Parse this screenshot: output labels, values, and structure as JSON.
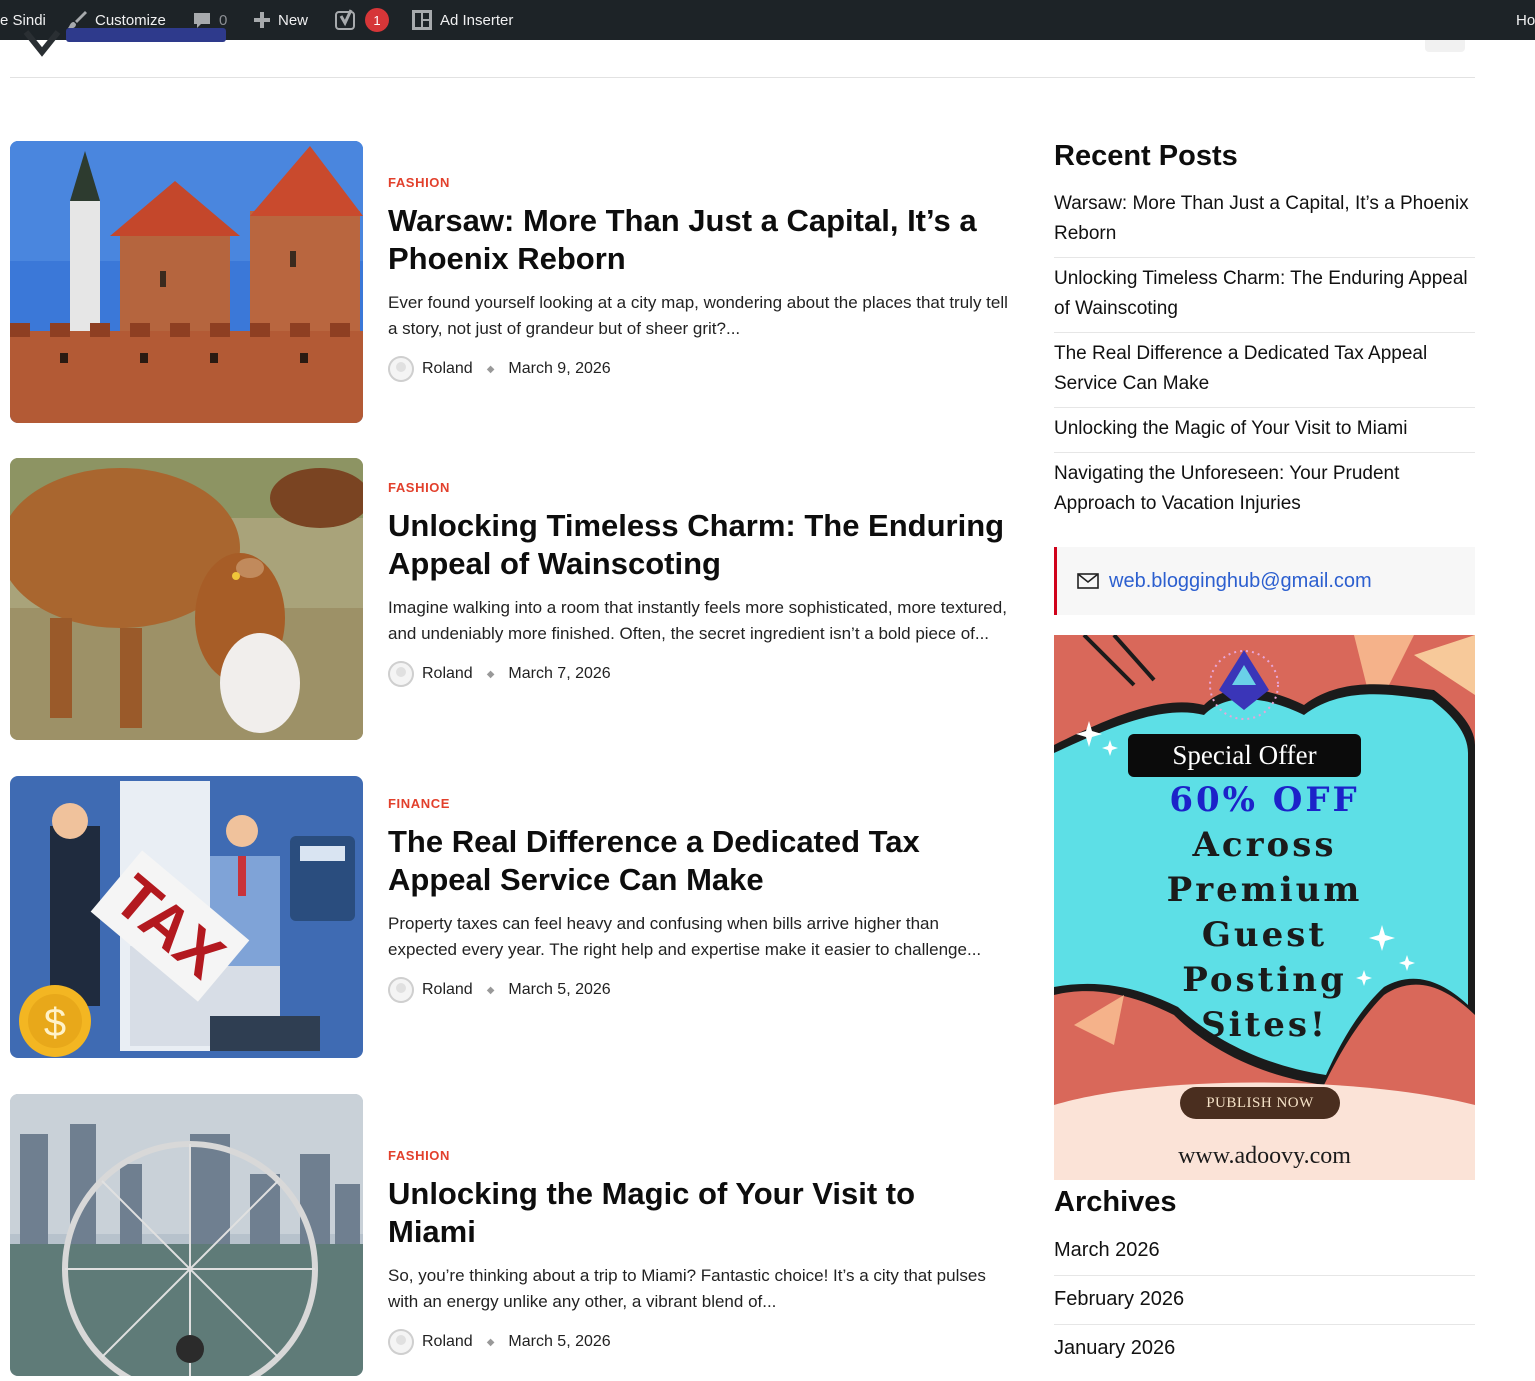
{
  "admin_bar": {
    "site_name": "e Sindi",
    "customize": "Customize",
    "comments_count": "0",
    "new": "New",
    "notifications": "1",
    "ad_inserter": "Ad Inserter",
    "howdy": "Ho"
  },
  "posts": [
    {
      "category": "FASHION",
      "title": "Warsaw: More Than Just a Capital, It’s a Phoenix Reborn",
      "excerpt": "Ever found yourself looking at a city map, wondering about the places that truly tell a story, not just of grandeur but of sheer grit?...",
      "author": "Roland",
      "date": "March 9, 2026"
    },
    {
      "category": "FASHION",
      "title": "Unlocking Timeless Charm: The Enduring Appeal of Wainscoting",
      "excerpt": "Imagine walking into a room that instantly feels more sophisticated, more textured, and undeniably more finished. Often, the secret ingredient isn’t a bold piece of...",
      "author": "Roland",
      "date": "March 7, 2026"
    },
    {
      "category": "FINANCE",
      "title": "The Real Difference a Dedicated Tax Appeal Service Can Make",
      "excerpt": "Property taxes can feel heavy and confusing when bills arrive higher than expected every year. The right help and expertise make it easier to challenge...",
      "author": "Roland",
      "date": "March 5, 2026",
      "image_text": "TAX"
    },
    {
      "category": "FASHION",
      "title": "Unlocking the Magic of Your Visit to Miami",
      "excerpt": "So, you’re thinking about a trip to Miami? Fantastic choice! It’s a city that pulses with an energy unlike any other, a vibrant blend of...",
      "author": "Roland",
      "date": "March 5, 2026"
    }
  ],
  "sidebar": {
    "recent_posts_title": "Recent Posts",
    "recent_posts": [
      "Warsaw: More Than Just a Capital, It’s a Phoenix Reborn",
      "Unlocking Timeless Charm: The Enduring Appeal of Wainscoting",
      "The Real Difference a Dedicated Tax Appeal Service Can Make",
      "Unlocking the Magic of Your Visit to Miami",
      "Navigating the Unforeseen: Your Prudent Approach to Vacation Injuries"
    ],
    "email": "web.blogginghub@gmail.com",
    "ad": {
      "offer": "Special Offer",
      "discount": "60% OFF",
      "lines": [
        "Across",
        "Premium",
        "Guest",
        "Posting",
        "Sites!"
      ],
      "button": "PUBLISH NOW",
      "url": "www.adoovy.com"
    },
    "archives_title": "Archives",
    "archives": [
      "March 2026",
      "February 2026",
      "January 2026"
    ]
  },
  "colors": {
    "admin_bar_bg": "#1d2327",
    "category_red": "#e2402c",
    "email_link": "#2c5fcf",
    "ad_cyan": "#5ddfe6",
    "ad_coral": "#d9685a"
  }
}
